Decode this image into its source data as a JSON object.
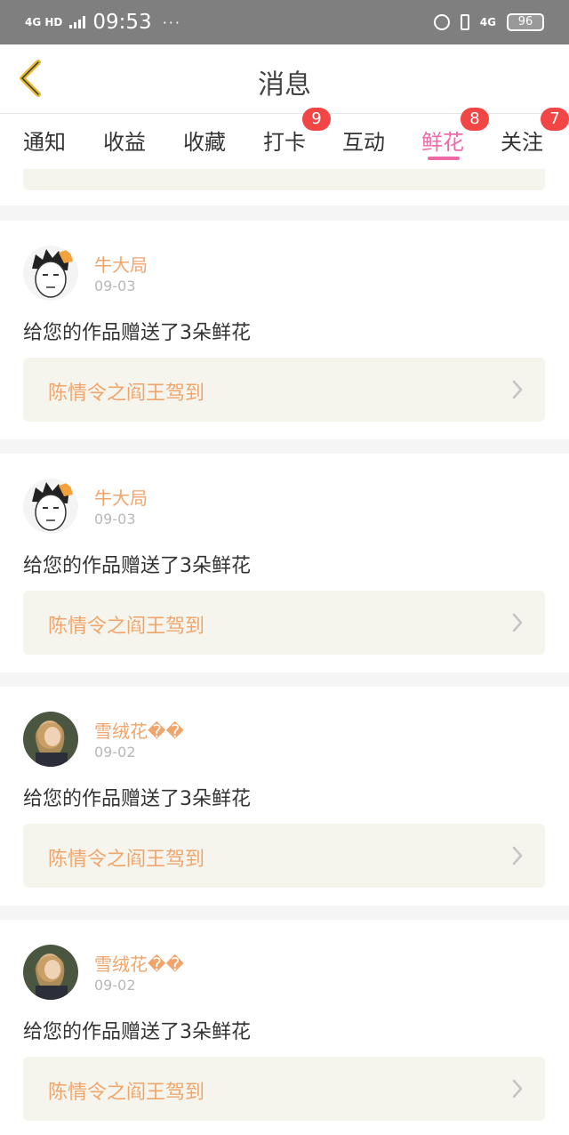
{
  "status_bar": {
    "network": "4G HD",
    "time": "09:53",
    "misc": "···",
    "net2": "4G",
    "battery": "96"
  },
  "nav": {
    "title": "消息"
  },
  "tabs": [
    {
      "label": "通知",
      "badge": ""
    },
    {
      "label": "收益",
      "badge": ""
    },
    {
      "label": "收藏",
      "badge": ""
    },
    {
      "label": "打卡",
      "badge": "9"
    },
    {
      "label": "互动",
      "badge": ""
    },
    {
      "label": "鲜花",
      "badge": "8"
    },
    {
      "label": "关注",
      "badge": "7"
    }
  ],
  "active_tab": "鲜花",
  "colors": {
    "accent_pink": "#ee6aa7",
    "name_orange": "#f0a56c",
    "badge_red": "#f24545",
    "work_bg": "#f5f5ed"
  },
  "messages": [
    {
      "avatar": "cartoon-boy-avatar",
      "name": "牛大局",
      "date": "09-03",
      "text": "给您的作品赠送了3朵鲜花",
      "work": "陈情令之阎王驾到"
    },
    {
      "avatar": "cartoon-boy-avatar",
      "name": "牛大局",
      "date": "09-03",
      "text": "给您的作品赠送了3朵鲜花",
      "work": "陈情令之阎王驾到"
    },
    {
      "avatar": "girl-photo-avatar",
      "name": "雪绒花��",
      "date": "09-02",
      "text": "给您的作品赠送了3朵鲜花",
      "work": "陈情令之阎王驾到"
    },
    {
      "avatar": "girl-photo-avatar",
      "name": "雪绒花��",
      "date": "09-02",
      "text": "给您的作品赠送了3朵鲜花",
      "work": "陈情令之阎王驾到"
    }
  ]
}
